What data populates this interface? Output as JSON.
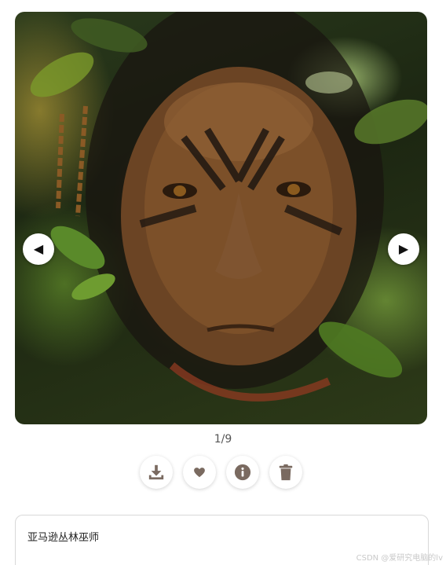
{
  "gallery": {
    "counter": "1/9",
    "image_subject": "tribal-shaman-portrait"
  },
  "nav": {
    "prev_icon": "triangle-left-icon",
    "next_icon": "triangle-right-icon",
    "prev_glyph": "◀",
    "next_glyph": "▶"
  },
  "actions": [
    {
      "icon": "download-icon"
    },
    {
      "icon": "heart-icon"
    },
    {
      "icon": "info-icon"
    },
    {
      "icon": "trash-icon"
    }
  ],
  "caption": {
    "text": "亚马逊丛林巫师"
  },
  "watermark": "CSDN @爱研究电脑的lv",
  "colors": {
    "icon": "#7a6a60",
    "button_bg": "#ffffff",
    "caption_border": "#d8d8d8"
  }
}
